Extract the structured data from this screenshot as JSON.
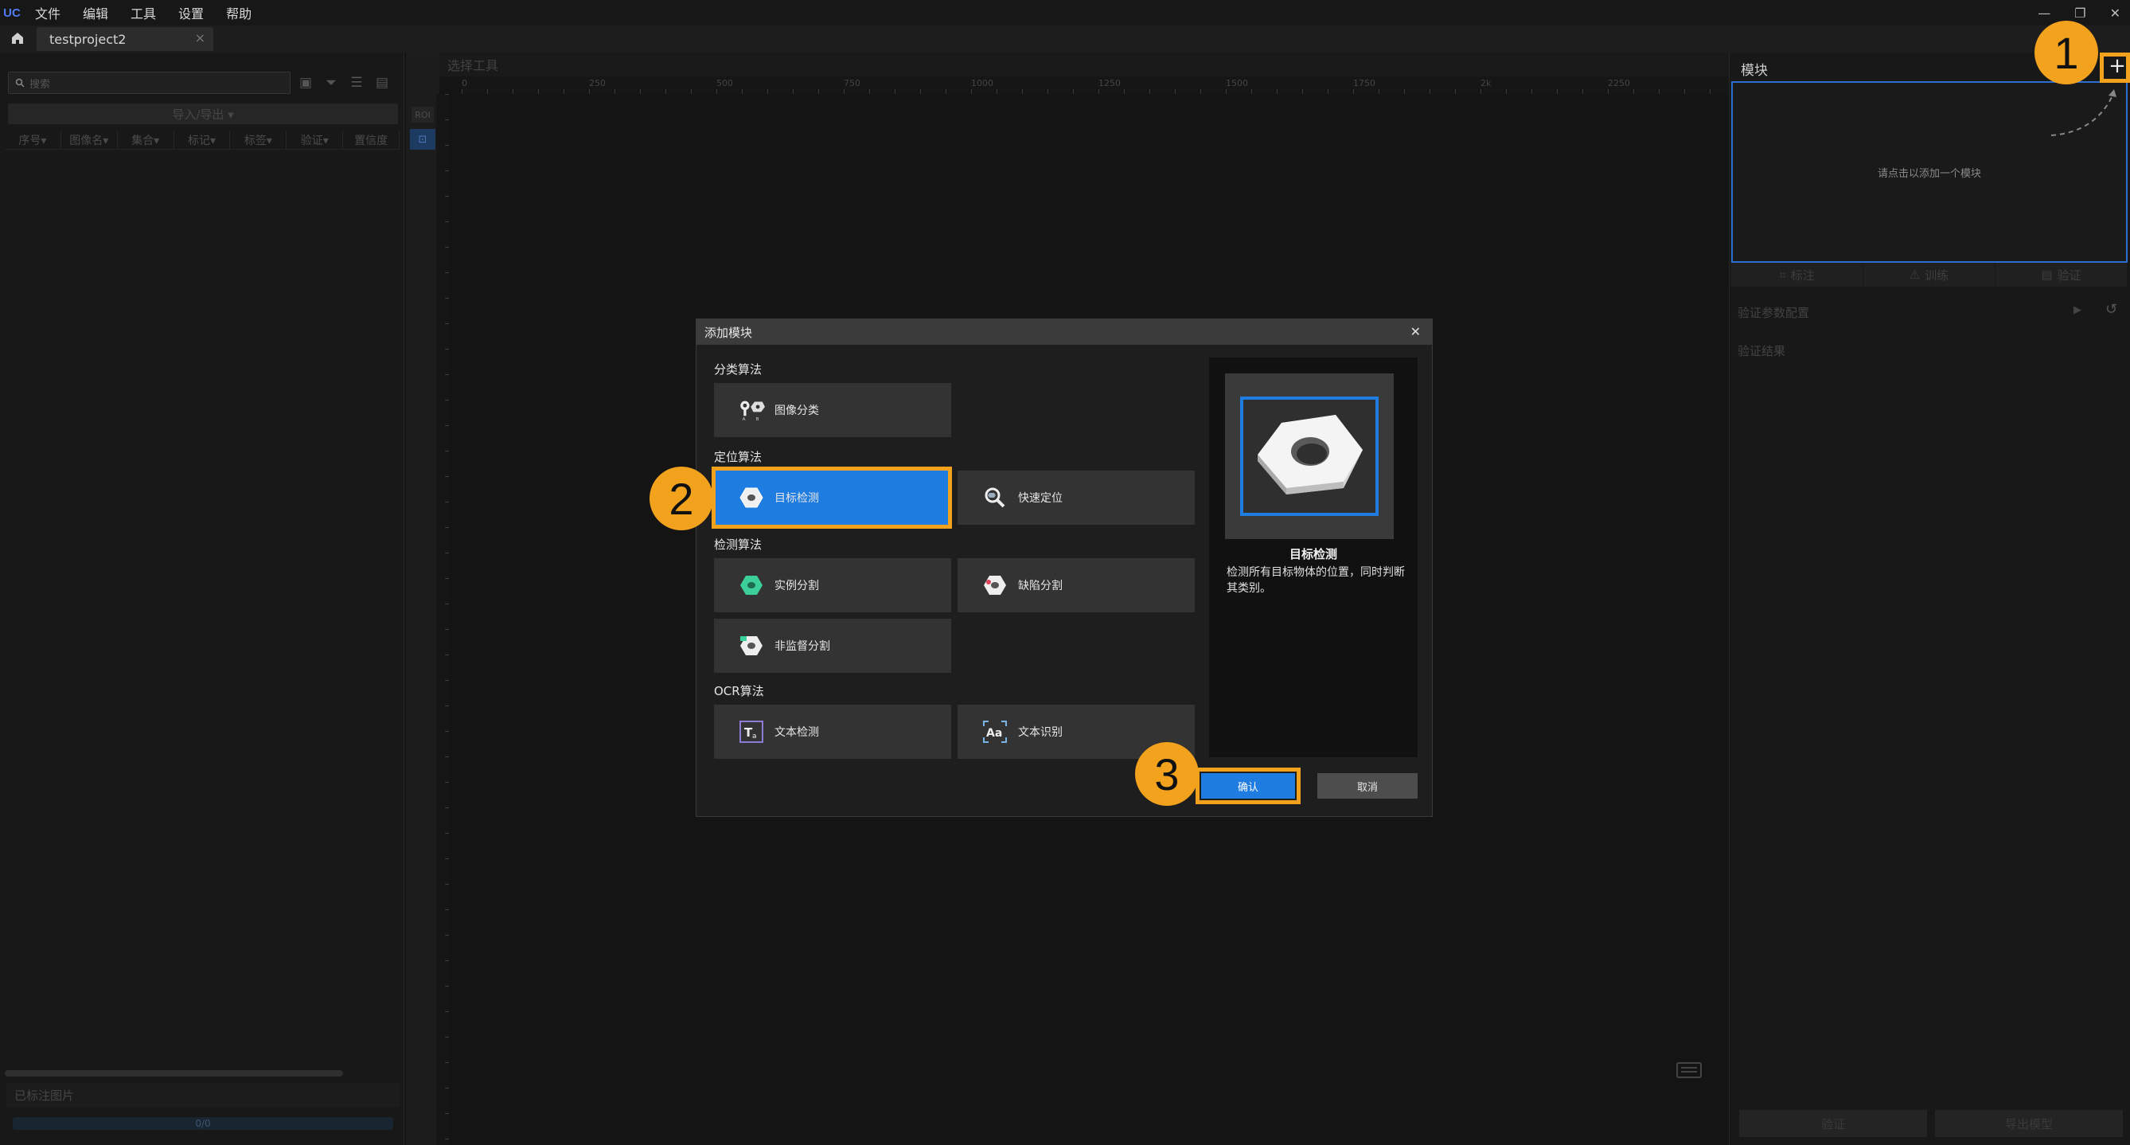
{
  "app": {
    "logo_text": "UC",
    "menu": [
      "文件",
      "编辑",
      "工具",
      "设置",
      "帮助"
    ],
    "window_controls": [
      "—",
      "❐",
      "✕"
    ]
  },
  "tabs": {
    "home_icon": "home-icon",
    "project_tab": "testproject2",
    "close": "×"
  },
  "left_panel": {
    "search_placeholder": "搜索",
    "import_export": "导入/导出 ▾",
    "columns": [
      "序号▾",
      "图像名▾",
      "集合▾",
      "标记▾",
      "标签▾",
      "验证▾",
      "置信度"
    ],
    "labeled_images": "已标注图片",
    "progress": "0/0"
  },
  "canvas": {
    "roi_label": "ROI",
    "header": "选择工具",
    "ruler_x": [
      "0",
      "250",
      "500",
      "750",
      "1000",
      "1250",
      "1500",
      "1750",
      "2k",
      "2250"
    ]
  },
  "right_panel": {
    "title": "模块",
    "add_button": "+",
    "empty_hint": "请点击以添加一个模块",
    "tabs": [
      "标注",
      "训练",
      "验证"
    ],
    "verify_config": "验证参数配置",
    "verify_result": "验证结果",
    "verify_button": "验证",
    "export_button": "导出模型"
  },
  "dialog": {
    "title": "添加模块",
    "close": "✕",
    "sections": {
      "classification": {
        "title": "分类算法",
        "items": [
          {
            "label": "图像分类",
            "icon": "image-classification-icon"
          }
        ]
      },
      "localization": {
        "title": "定位算法",
        "items": [
          {
            "label": "目标检测",
            "icon": "object-detection-icon",
            "selected": true
          },
          {
            "label": "快速定位",
            "icon": "fast-positioning-icon"
          }
        ]
      },
      "detection": {
        "title": "检测算法",
        "items": [
          {
            "label": "实例分割",
            "icon": "instance-segmentation-icon"
          },
          {
            "label": "缺陷分割",
            "icon": "defect-segmentation-icon"
          },
          {
            "label": "非监督分割",
            "icon": "unsupervised-segmentation-icon"
          }
        ]
      },
      "ocr": {
        "title": "OCR算法",
        "items": [
          {
            "label": "文本检测",
            "icon": "text-detection-icon"
          },
          {
            "label": "文本识别",
            "icon": "text-recognition-icon"
          }
        ]
      }
    },
    "preview": {
      "title": "目标检测",
      "description": "检测所有目标物体的位置，同时判断其类别。",
      "image": "hex-nut-icon"
    },
    "confirm": "确认",
    "cancel": "取消"
  },
  "annotations": {
    "step1": "1",
    "step2": "2",
    "step3": "3",
    "highlight_color": "#f2a21c"
  },
  "colors": {
    "accent": "#1f7ce0",
    "callout": "#f2a21c",
    "background": "#141414"
  }
}
